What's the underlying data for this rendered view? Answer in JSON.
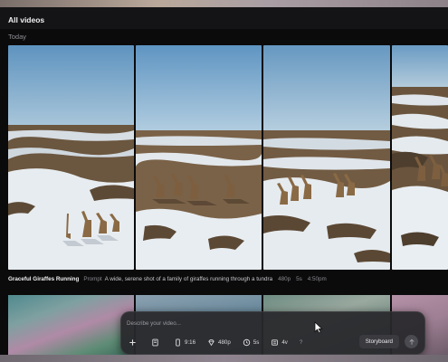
{
  "page": {
    "title": "All videos",
    "section": "Today"
  },
  "video": {
    "title": "Graceful Giraffes Running",
    "prompt_label": "Prompt",
    "prompt_text": "A wide, serene shot of a family of giraffes running through a tundra",
    "resolution": "480p",
    "duration": "5s",
    "time": "4:50pm"
  },
  "composer": {
    "placeholder": "Describe your video...",
    "toolbar": {
      "add_icon": "plus-icon",
      "library_icon": "film-library-icon",
      "aspect_icon": "portrait-frame-icon",
      "aspect_label": "9:16",
      "quality_icon": "diamond-icon",
      "quality_label": "480p",
      "duration_icon": "clock-icon",
      "duration_label": "5s",
      "variations_icon": "stack-icon",
      "variations_label": "4v",
      "help_label": "?"
    },
    "storyboard_label": "Storyboard",
    "send_icon": "arrow-up-icon"
  },
  "colors": {
    "background": "#0b0b0c",
    "composer": "#28282c",
    "sky": "#6fa3c8",
    "snow": "#e9eef2",
    "ground": "#6a553f"
  }
}
